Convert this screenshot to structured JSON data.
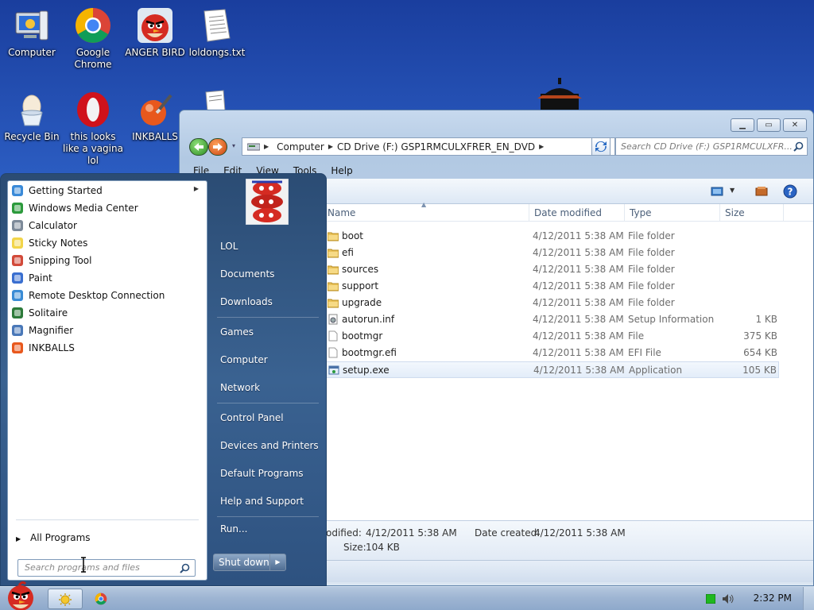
{
  "desktop": {
    "icons": [
      {
        "label": "Computer",
        "icon": "computer-icon"
      },
      {
        "label": "Google Chrome",
        "icon": "chrome-icon"
      },
      {
        "label": "ANGER BIRD",
        "icon": "angry-bird-icon"
      },
      {
        "label": "loldongs.txt",
        "icon": "text-file-icon"
      },
      {
        "label": "Recycle Bin",
        "icon": "recycle-bin-icon"
      },
      {
        "label": "this looks like a vagina lol",
        "icon": "opera-icon"
      },
      {
        "label": "INKBALLS",
        "icon": "inkballs-icon"
      }
    ]
  },
  "explorer": {
    "breadcrumb": [
      "Computer",
      "CD Drive (F:) GSP1RMCULXFRER_EN_DVD"
    ],
    "search_placeholder": "Search CD Drive (F:) GSP1RMCULXFR...",
    "menu": [
      "File",
      "Edit",
      "View",
      "Tools",
      "Help"
    ],
    "columns": {
      "name": "Name",
      "date": "Date modified",
      "type": "Type",
      "size": "Size"
    },
    "files": [
      {
        "name": "boot",
        "date": "4/12/2011 5:38 AM",
        "type": "File folder",
        "size": "",
        "kind": "folder"
      },
      {
        "name": "efi",
        "date": "4/12/2011 5:38 AM",
        "type": "File folder",
        "size": "",
        "kind": "folder"
      },
      {
        "name": "sources",
        "date": "4/12/2011 5:38 AM",
        "type": "File folder",
        "size": "",
        "kind": "folder"
      },
      {
        "name": "support",
        "date": "4/12/2011 5:38 AM",
        "type": "File folder",
        "size": "",
        "kind": "folder"
      },
      {
        "name": "upgrade",
        "date": "4/12/2011 5:38 AM",
        "type": "File folder",
        "size": "",
        "kind": "folder"
      },
      {
        "name": "autorun.inf",
        "date": "4/12/2011 5:38 AM",
        "type": "Setup Information",
        "size": "1 KB",
        "kind": "inf"
      },
      {
        "name": "bootmgr",
        "date": "4/12/2011 5:38 AM",
        "type": "File",
        "size": "375 KB",
        "kind": "file"
      },
      {
        "name": "bootmgr.efi",
        "date": "4/12/2011 5:38 AM",
        "type": "EFI File",
        "size": "654 KB",
        "kind": "file"
      },
      {
        "name": "setup.exe",
        "date": "4/12/2011 5:38 AM",
        "type": "Application",
        "size": "105 KB",
        "kind": "exe",
        "selected": true
      }
    ],
    "details": {
      "modified_label": "odified:",
      "modified_value": "4/12/2011 5:38 AM",
      "created_label": "Date created:",
      "created_value": "4/12/2011 5:38 AM",
      "size_label": "Size:",
      "size_value": "104 KB"
    }
  },
  "start_menu": {
    "programs": [
      {
        "label": "Getting Started",
        "icon": "getting-started-icon",
        "submenu": true
      },
      {
        "label": "Windows Media Center",
        "icon": "media-center-icon"
      },
      {
        "label": "Calculator",
        "icon": "calculator-icon"
      },
      {
        "label": "Sticky Notes",
        "icon": "sticky-notes-icon"
      },
      {
        "label": "Snipping Tool",
        "icon": "snipping-tool-icon"
      },
      {
        "label": "Paint",
        "icon": "paint-icon"
      },
      {
        "label": "Remote Desktop Connection",
        "icon": "remote-desktop-icon"
      },
      {
        "label": "Solitaire",
        "icon": "solitaire-icon"
      },
      {
        "label": "Magnifier",
        "icon": "magnifier-icon"
      },
      {
        "label": "INKBALLS",
        "icon": "inkballs-icon"
      }
    ],
    "all_programs": "All Programs",
    "search_placeholder": "Search programs and files",
    "right_links": [
      "LOL",
      "Documents",
      "Downloads",
      "Games",
      "Computer",
      "Network",
      "Control Panel",
      "Devices and Printers",
      "Default Programs",
      "Help and Support",
      "Run..."
    ],
    "shutdown": "Shut down"
  },
  "taskbar": {
    "clock": "2:32 PM"
  }
}
